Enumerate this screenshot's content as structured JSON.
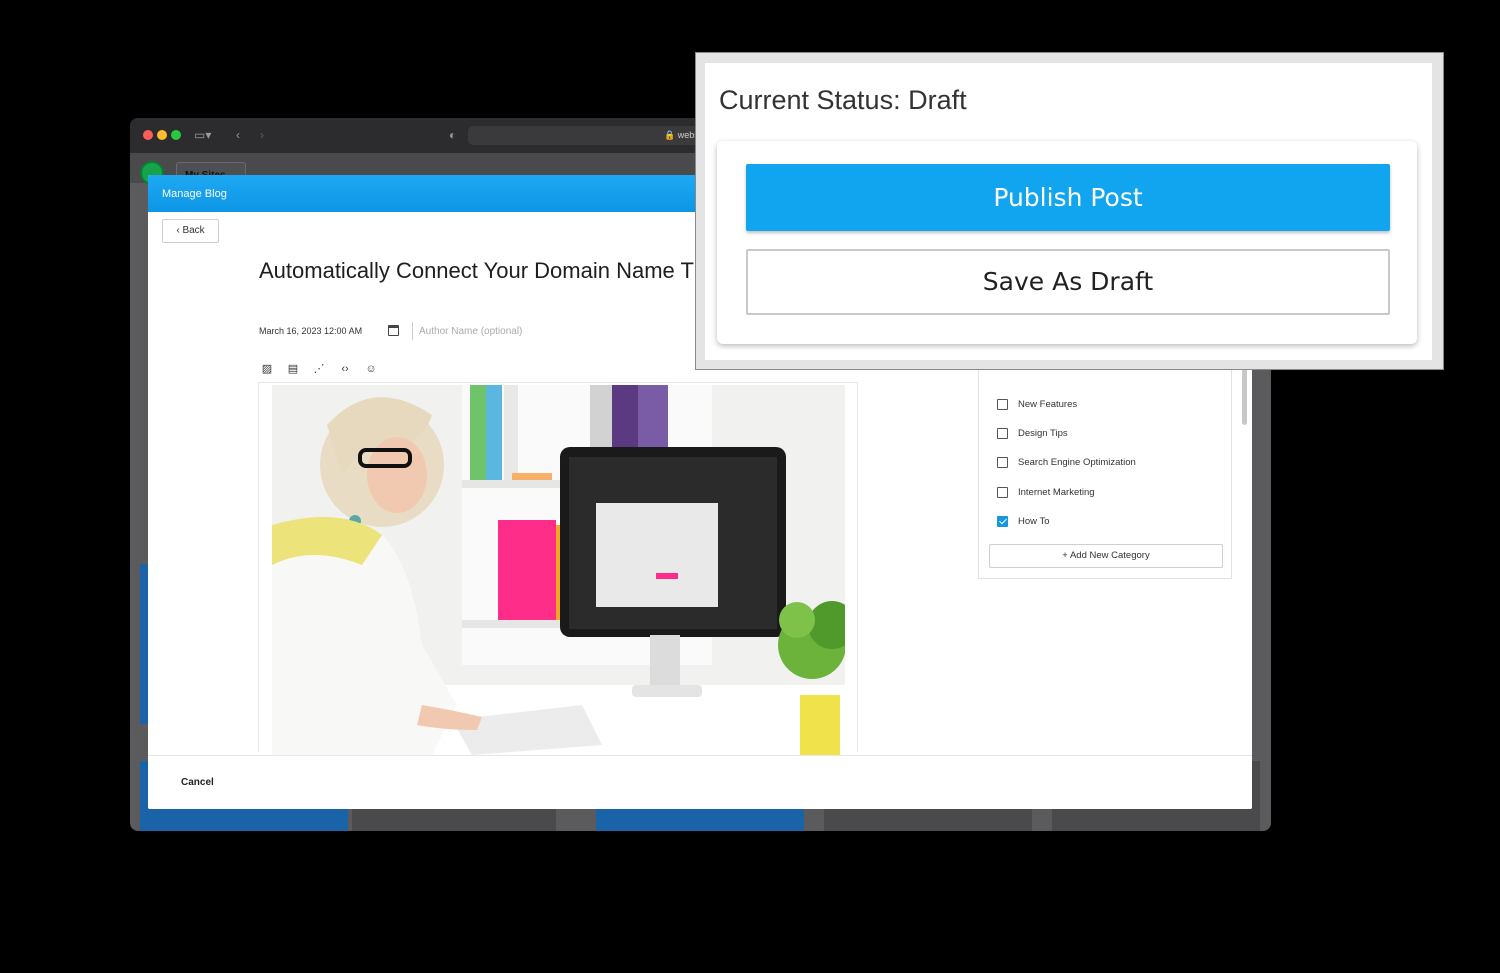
{
  "browser": {
    "url_text": "webs",
    "my_sites_label": "My Sites"
  },
  "modal": {
    "header_title": "Manage Blog",
    "back_label": "Back",
    "post_title": "Automatically Connect Your Domain Name T Website",
    "post_date": "March 16, 2023 12:00 AM",
    "author_placeholder": "Author Name (optional)",
    "toolbar_icons": [
      "image-icon",
      "video-icon",
      "layout-icon",
      "code-icon",
      "emoji-icon"
    ],
    "categories": [
      {
        "label": "New Features",
        "checked": false
      },
      {
        "label": "Design Tips",
        "checked": false
      },
      {
        "label": "Search Engine Optimization",
        "checked": false
      },
      {
        "label": "Internet Marketing",
        "checked": false
      },
      {
        "label": "How To",
        "checked": true
      }
    ],
    "add_category_label": "+ Add New Category",
    "cancel_label": "Cancel"
  },
  "status": {
    "title": "Current Status: Draft",
    "publish_label": "Publish Post",
    "draft_label": "Save As Draft"
  },
  "colors": {
    "accent": "#11a5f0",
    "header_blue": "#1fa8f2",
    "checkbox_checked": "#1597e0"
  }
}
